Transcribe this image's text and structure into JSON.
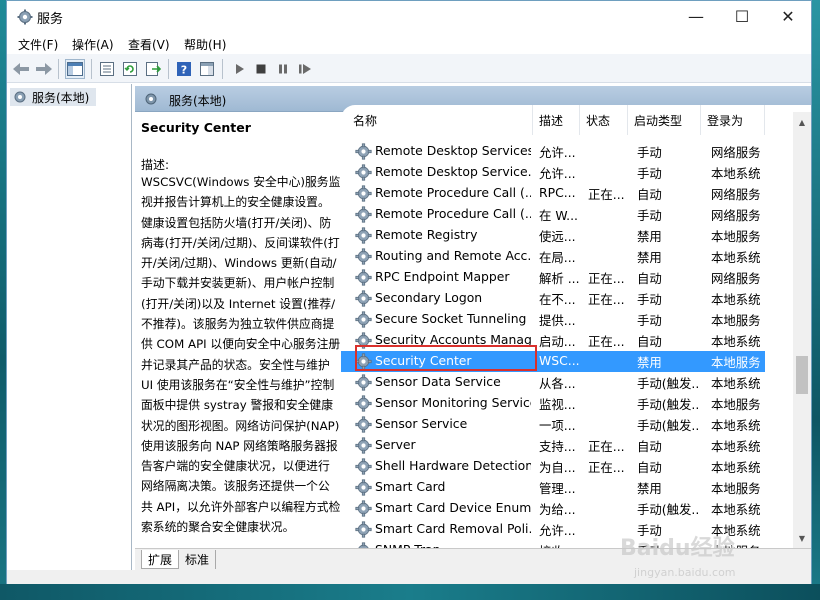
{
  "window": {
    "title": "服务",
    "minimize_symbol": "—",
    "maximize_symbol": "☐",
    "close_symbol": "✕"
  },
  "menu": [
    "文件(F)",
    "操作(A)",
    "查看(V)",
    "帮助(H)"
  ],
  "toolbar": {
    "buttons": [
      "back-arrow-icon",
      "forward-arrow-icon",
      "show-hide-console-tree-icon",
      "properties-icon",
      "refresh-icon",
      "export-list-icon",
      "help-icon",
      "action-pane-icon",
      "start-service-icon",
      "stop-service-icon",
      "pause-service-icon",
      "restart-service-icon"
    ]
  },
  "tree": {
    "node_label": "服务(本地)"
  },
  "main": {
    "header_title": "服务(本地)"
  },
  "description": {
    "service_name": "Security Center",
    "label": "描述:",
    "text": "WSCSVC(Windows 安全中心)服务监视并报告计算机上的安全健康设置。健康设置包括防火墙(打开/关闭)、防病毒(打开/关闭/过期)、反间谍软件(打开/关闭/过期)、Windows 更新(自动/手动下载并安装更新)、用户帐户控制(打开/关闭)以及 Internet 设置(推荐/不推荐)。该服务为独立软件供应商提供 COM API 以便向安全中心服务注册并记录其产品的状态。安全性与维护 UI 使用该服务在“安全性与维护”控制面板中提供 systray 警报和安全健康状况的图形视图。网络访问保护(NAP)使用该服务向 NAP 网络策略服务器报告客户端的安全健康状况，以便进行网络隔离决策。该服务还提供一个公共 API，以允许外部客户以编程方式检索系统的聚合安全健康状况。"
  },
  "columns": [
    "名称",
    "描述",
    "状态",
    "启动类型",
    "登录为"
  ],
  "services": [
    {
      "name": "Remote Desktop Services",
      "desc": "允许...",
      "status": "",
      "startup": "手动",
      "logon": "网络服务"
    },
    {
      "name": "Remote Desktop Service...",
      "desc": "允许...",
      "status": "",
      "startup": "手动",
      "logon": "本地系统"
    },
    {
      "name": "Remote Procedure Call (...",
      "desc": "RPC...",
      "status": "正在...",
      "startup": "自动",
      "logon": "网络服务"
    },
    {
      "name": "Remote Procedure Call (...",
      "desc": "在 W...",
      "status": "",
      "startup": "手动",
      "logon": "网络服务"
    },
    {
      "name": "Remote Registry",
      "desc": "使远...",
      "status": "",
      "startup": "禁用",
      "logon": "本地服务"
    },
    {
      "name": "Routing and Remote Acc...",
      "desc": "在局...",
      "status": "",
      "startup": "禁用",
      "logon": "本地系统"
    },
    {
      "name": "RPC Endpoint Mapper",
      "desc": "解析 ...",
      "status": "正在...",
      "startup": "自动",
      "logon": "网络服务"
    },
    {
      "name": "Secondary Logon",
      "desc": "在不...",
      "status": "正在...",
      "startup": "手动",
      "logon": "本地系统"
    },
    {
      "name": "Secure Socket Tunneling ...",
      "desc": "提供...",
      "status": "",
      "startup": "手动",
      "logon": "本地服务"
    },
    {
      "name": "Security Accounts Manag...",
      "desc": "启动...",
      "status": "正在...",
      "startup": "自动",
      "logon": "本地系统"
    },
    {
      "name": "Security Center",
      "desc": "WSC...",
      "status": "",
      "startup": "禁用",
      "logon": "本地服务",
      "selected": true
    },
    {
      "name": "Sensor Data Service",
      "desc": "从各...",
      "status": "",
      "startup": "手动(触发...",
      "logon": "本地系统"
    },
    {
      "name": "Sensor Monitoring Service",
      "desc": "监视...",
      "status": "",
      "startup": "手动(触发...",
      "logon": "本地服务"
    },
    {
      "name": "Sensor Service",
      "desc": "一项...",
      "status": "",
      "startup": "手动(触发...",
      "logon": "本地系统"
    },
    {
      "name": "Server",
      "desc": "支持...",
      "status": "正在...",
      "startup": "自动",
      "logon": "本地系统"
    },
    {
      "name": "Shell Hardware Detection",
      "desc": "为自...",
      "status": "正在...",
      "startup": "自动",
      "logon": "本地系统"
    },
    {
      "name": "Smart Card",
      "desc": "管理...",
      "status": "",
      "startup": "禁用",
      "logon": "本地服务"
    },
    {
      "name": "Smart Card Device Enum...",
      "desc": "为给...",
      "status": "",
      "startup": "手动(触发...",
      "logon": "本地系统"
    },
    {
      "name": "Smart Card Removal Poli...",
      "desc": "允许...",
      "status": "",
      "startup": "手动",
      "logon": "本地系统"
    },
    {
      "name": "SNMP Trap",
      "desc": "接收...",
      "status": "",
      "startup": "手动",
      "logon": "本地服务"
    }
  ],
  "tabs": [
    "扩展",
    "标准"
  ],
  "watermark": {
    "logo": "Baidu经验",
    "url": "jingyan.baidu.com"
  },
  "colors": {
    "selection": "#3399ff",
    "highlight_box": "#d9302c",
    "header_band": "#a9c2db"
  }
}
